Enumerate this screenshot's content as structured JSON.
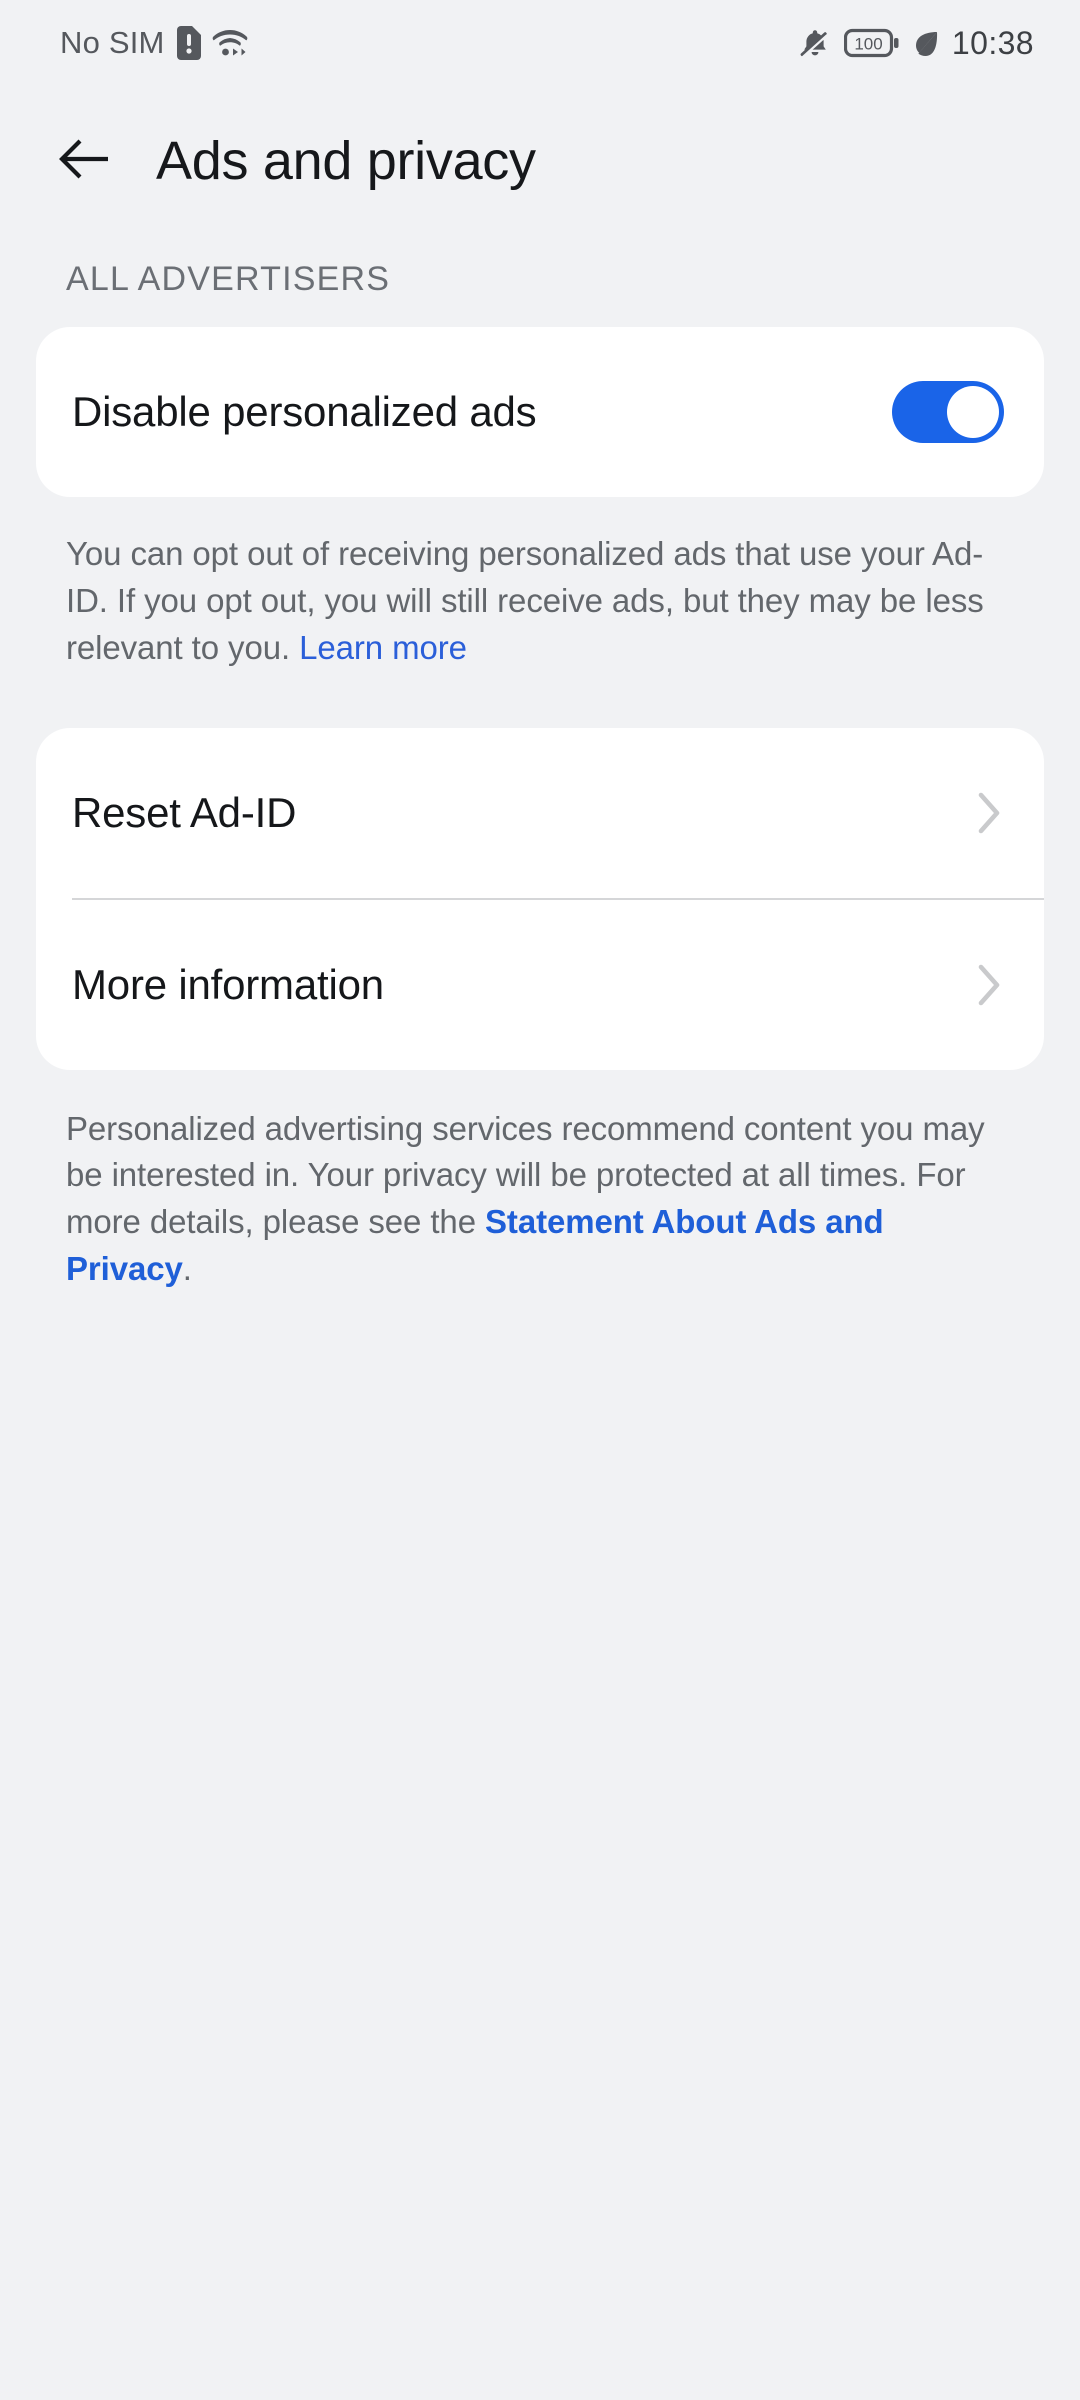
{
  "status_bar": {
    "carrier": "No SIM",
    "sim_icon": "sim-card-alert-icon",
    "wifi_icon": "wifi-data-icon",
    "bell_icon": "bell-muted-icon",
    "battery_level": "100",
    "battery_icon": "battery-full-icon",
    "power_saving_icon": "leaf-icon",
    "clock": "10:38"
  },
  "header": {
    "back_icon": "arrow-left-icon",
    "title": "Ads and privacy"
  },
  "section": {
    "label": "ALL ADVERTISERS"
  },
  "toggle_row": {
    "label": "Disable personalized ads",
    "state": "on",
    "accent_color": "#1a64e8"
  },
  "help_text_1": {
    "body": "You can opt out of receiving personalized ads that use your Ad-ID. If you opt out, you will still receive ads, but they may be less relevant to you. ",
    "link": "Learn more"
  },
  "links_card": {
    "rows": [
      {
        "label": "Reset Ad-ID",
        "chevron": "chevron-right-icon"
      },
      {
        "label": "More information",
        "chevron": "chevron-right-icon"
      }
    ]
  },
  "help_text_2": {
    "part1": "Personalized advertising services recommend content you may be interested in. Your privacy will be protected at all times. For more details, please see the ",
    "link": "Statement About Ads and Privacy",
    "part2": "."
  },
  "colors": {
    "background": "#f1f2f4",
    "card": "#ffffff",
    "link": "#2b5fd9",
    "accent": "#1a64e8",
    "secondary_text": "#63676c"
  }
}
